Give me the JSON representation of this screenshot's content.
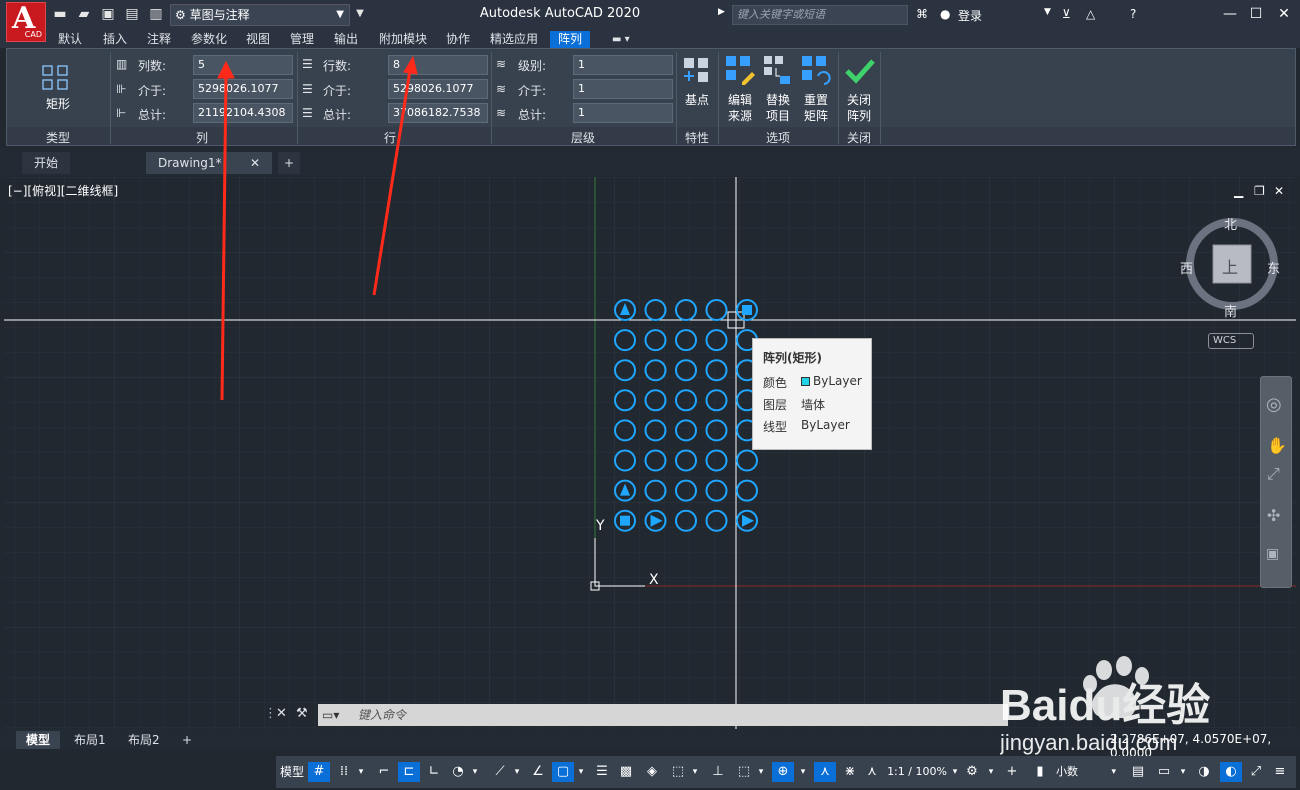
{
  "app": {
    "title": "Autodesk AutoCAD 2020",
    "logo_letter": "A",
    "logo_sub": "CAD"
  },
  "workspace": {
    "name": "草图与注释"
  },
  "search": {
    "placeholder": "键入关键字或短语"
  },
  "user": {
    "login": "登录"
  },
  "ribbon_tabs": [
    "默认",
    "插入",
    "注释",
    "参数化",
    "视图",
    "管理",
    "输出",
    "附加模块",
    "协作",
    "精选应用",
    "阵列"
  ],
  "active_tab": "阵列",
  "ribbon": {
    "type_group": {
      "button": "矩形",
      "name": "类型"
    },
    "columns_group": {
      "count_label": "列数:",
      "count": "5",
      "between_label": "介于:",
      "between": "5298026.1077",
      "total_label": "总计:",
      "total": "21192104.4308",
      "name": "列"
    },
    "rows_group": {
      "count_label": "行数:",
      "count": "8",
      "between_label": "介于:",
      "between": "5298026.1077",
      "total_label": "总计:",
      "total": "37086182.7538",
      "name": "行"
    },
    "levels_group": {
      "count_label": "级别:",
      "count": "1",
      "between_label": "介于:",
      "between": "1",
      "total_label": "总计:",
      "total": "1",
      "name": "层级"
    },
    "props_group": {
      "base_point": "基点",
      "name": "特性"
    },
    "options_group": {
      "edit_source": "编辑\n来源",
      "replace_item": "替换\n项目",
      "reset_matrix": "重置\n矩阵",
      "name": "选项"
    },
    "close_group": {
      "close": "关闭\n阵列",
      "name": "关闭"
    }
  },
  "doc_tabs": {
    "start": "开始",
    "drawing": "Drawing1*"
  },
  "viewport": {
    "label": "[−][俯视][二维线框]"
  },
  "viewcube": {
    "north": "北",
    "south": "南",
    "east": "东",
    "west": "西",
    "top": "上",
    "wcs": "WCS"
  },
  "tooltip": {
    "title": "阵列(矩形)",
    "color_label": "颜色",
    "color_value": "ByLayer",
    "layer_label": "图层",
    "layer_value": "墙体",
    "linetype_label": "线型",
    "linetype_value": "ByLayer",
    "swatch": "#22d3e6"
  },
  "ucs": {
    "x": "X",
    "y": "Y"
  },
  "command": {
    "placeholder": "键入命令"
  },
  "layout_tabs": [
    "模型",
    "布局1",
    "布局2"
  ],
  "status": {
    "model": "模型",
    "scale": "1:1 / 100%",
    "units": "小数"
  },
  "coords": "2.2786E+07, 4.0570E+07, 0.0000",
  "watermark": {
    "brand": "Baidu经验",
    "url": "jingyan.baidu.com"
  },
  "array": {
    "columns": 5,
    "rows": 8
  },
  "colors": {
    "accent": "#0a6fd6",
    "circle": "#1fa6ff",
    "annotation": "#ff2a1a"
  }
}
